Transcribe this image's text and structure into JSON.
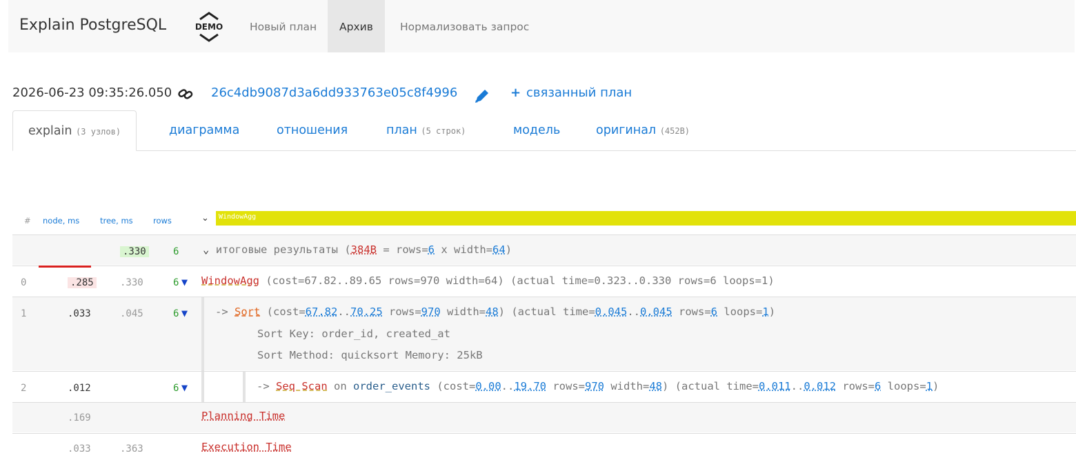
{
  "header": {
    "brand": "Explain PostgreSQL",
    "demo_badge": "DEMO",
    "nav": [
      "Новый план",
      "Архив",
      "Нормализовать запрос"
    ],
    "active_nav": "Архив"
  },
  "meta": {
    "timestamp": "2026-06-23 09:35:26.050",
    "plan_id": "26c4db9087d3a6dd933763e05c8f4996",
    "related": "связанный план"
  },
  "tabs": [
    {
      "label": "explain",
      "sub": "(3 узлов)"
    },
    {
      "label": "диаграмма",
      "sub": ""
    },
    {
      "label": "отношения",
      "sub": ""
    },
    {
      "label": "план",
      "sub": "(5 строк)"
    },
    {
      "label": "модель",
      "sub": ""
    },
    {
      "label": "оригинал",
      "sub": "(452B)"
    }
  ],
  "table": {
    "headers": {
      "n": "#",
      "node": "node, ms",
      "tree": "tree, ms",
      "rows": "rows"
    },
    "root_label": "WindowAgg",
    "summary": {
      "tree": ".330",
      "rows": "6",
      "text": "итоговые результаты",
      "bytes": "384B",
      "rows_expr": "rows=",
      "rows_val": "6",
      "x": "x",
      "width_expr": "width=",
      "width_val": "64"
    },
    "rows": [
      {
        "n": "0",
        "node": ".285",
        "tree": ".330",
        "rows": "6",
        "node_name": "WindowAgg",
        "cost_a": "67.82",
        "cost_b": "89.65",
        "prows": "970",
        "pwidth": "64",
        "time_a": "0.323",
        "time_b": "0.330",
        "arows": "6",
        "loops": "1"
      },
      {
        "n": "1",
        "node": ".033",
        "tree": ".045",
        "rows": "6",
        "node_name": "Sort",
        "cost_a": "67.82",
        "cost_b": "70.25",
        "prows": "970",
        "pwidth": "48",
        "time_a": "0.045",
        "time_b": "0.045",
        "arows": "6",
        "loops": "1",
        "details": [
          "Sort Key: order_id, created_at",
          "Sort Method: quicksort  Memory: 25kB"
        ]
      },
      {
        "n": "2",
        "node": ".012",
        "tree": "",
        "rows": "6",
        "node_name": "Seq Scan",
        "on": "on",
        "relation": "order_events",
        "cost_a": "0.00",
        "cost_b": "19.70",
        "prows": "970",
        "pwidth": "48",
        "time_a": "0.011",
        "time_b": "0.012",
        "arows": "6",
        "loops": "1"
      }
    ],
    "planning": {
      "node": ".169",
      "label": "Planning Time"
    },
    "execution": {
      "node": ".033",
      "tree": ".363",
      "label": "Execution Time"
    }
  },
  "colors": {
    "highlight_bar": "#e2e20a",
    "link": "#1a7bd6",
    "node_red": "#c9302c"
  }
}
